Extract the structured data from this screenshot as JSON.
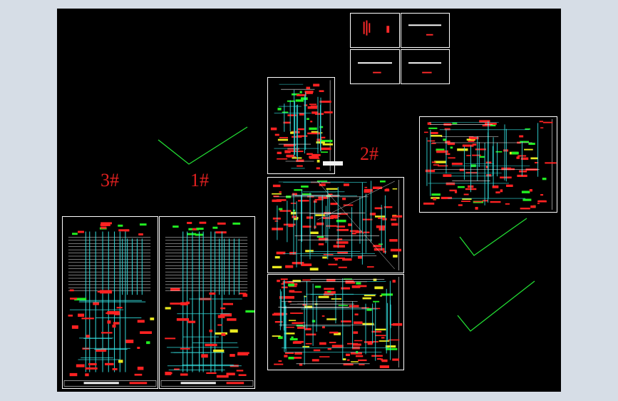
{
  "canvas": {
    "background": "#000000",
    "frame_background": "#d6dde6"
  },
  "labels": {
    "building_3": "3#",
    "building_1": "1#",
    "building_2": "2#"
  },
  "colors": {
    "label": "#e02020",
    "check": "#22dd33",
    "wire_red": "#ff2222",
    "wire_cyan": "#33dddd",
    "wire_green": "#22ee22",
    "wire_white": "#f0f0f0",
    "wire_yellow": "#e8e820"
  },
  "checkmarks": [
    "check-icon-top",
    "check-icon-right-1",
    "check-icon-right-2"
  ],
  "sheets": [
    "sheet-3-riser",
    "sheet-1-riser",
    "sheet-2-upper",
    "sheet-2-middle",
    "sheet-2-lower",
    "sheet-right-system",
    "sheet-cover-1",
    "sheet-cover-2",
    "sheet-cover-3",
    "sheet-cover-4"
  ]
}
